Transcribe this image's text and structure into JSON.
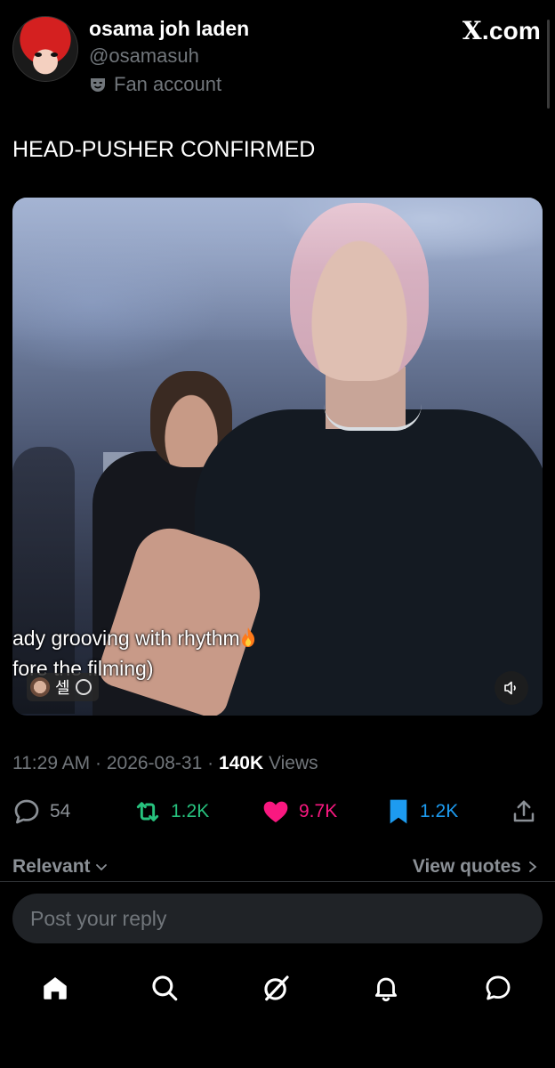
{
  "author": {
    "display_name": "osama joh laden",
    "handle": "@osamasuh",
    "label": "Fan account",
    "label_icon": "theater-mask-icon"
  },
  "brand": "X.com",
  "tweet": {
    "text": "HEAD-PUSHER CONFIRMED"
  },
  "media": {
    "subtitle_line1": "ady grooving with rhythm",
    "subtitle_line2": "fore the filming)",
    "creator_name": "셀",
    "mute_icon": "speaker-mute-icon"
  },
  "meta": {
    "time": "11:29 AM",
    "date": "2026-08-31",
    "views_count": "140K",
    "views_label": "Views"
  },
  "actions": {
    "replies": "54",
    "reposts": "1.2K",
    "likes": "9.7K",
    "bookmarks": "1.2K"
  },
  "colors": {
    "repost": "#27c27e",
    "like": "#f91880",
    "bookmark": "#1d9bf0",
    "muted_text": "#71767b"
  },
  "filters": {
    "sort_label": "Relevant",
    "quotes_label": "View quotes"
  },
  "reply": {
    "placeholder": "Post your reply"
  },
  "nav": [
    "home-icon",
    "search-icon",
    "grok-icon",
    "notifications-icon",
    "messages-icon"
  ]
}
